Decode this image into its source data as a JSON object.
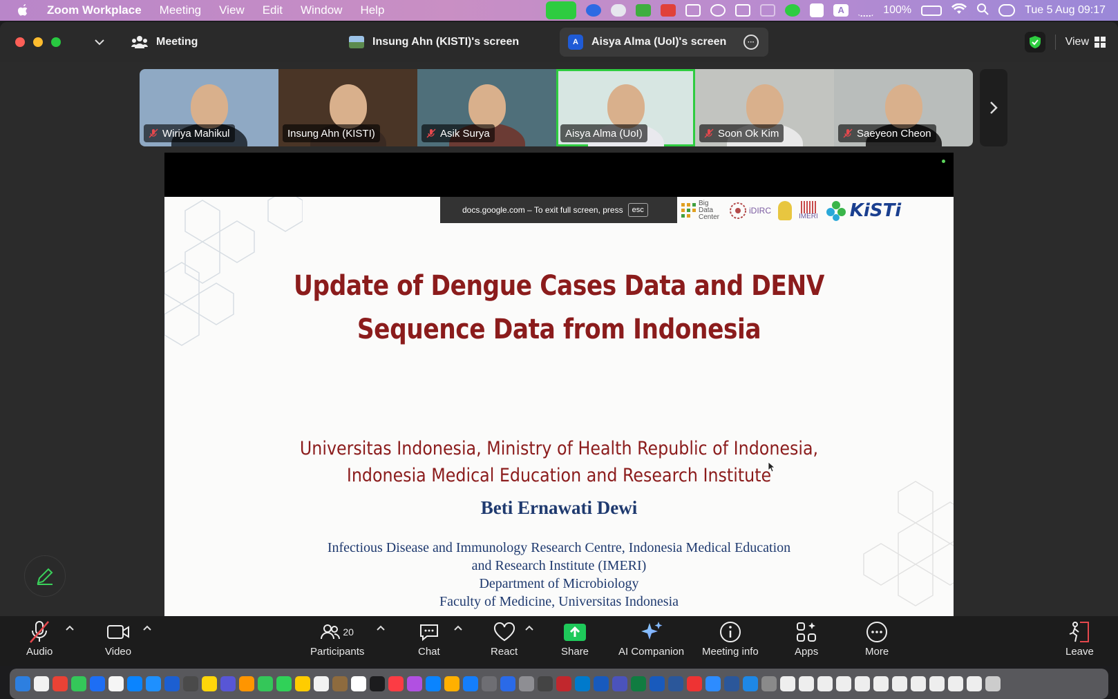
{
  "menubar": {
    "app_name": "Zoom Workplace",
    "items": [
      "Meeting",
      "View",
      "Edit",
      "Window",
      "Help"
    ],
    "battery": "100%",
    "clock": "Tue 5 Aug  09:17",
    "input_source": "A"
  },
  "titlebar": {
    "meeting_tab": "Meeting",
    "screen_tabs": [
      "Insung Ahn (KISTI)'s screen",
      "Aisya Alma (UoI)'s screen"
    ],
    "active_badge": "A",
    "view_label": "View"
  },
  "participants": [
    {
      "name": "Wiriya Mahikul",
      "muted": true,
      "bg": "#8fa9c4",
      "shirt": "#2b3540"
    },
    {
      "name": "Insung Ahn (KISTI)",
      "muted": false,
      "bg": "#4a3526",
      "shirt": "#3a2a22"
    },
    {
      "name": "Asik Surya",
      "muted": true,
      "bg": "#4f6f7a",
      "shirt": "#6b3b34"
    },
    {
      "name": "Aisya Alma (UoI)",
      "muted": false,
      "bg": "#d7e6e2",
      "shirt": "#e9e9ee",
      "active": true
    },
    {
      "name": "Soon Ok Kim",
      "muted": true,
      "bg": "#c2c4c0",
      "shirt": "#e8e8e8"
    },
    {
      "name": "Saeyeon Cheon",
      "muted": true,
      "bg": "#b9bdbb",
      "shirt": "#2a2a2a"
    }
  ],
  "shared_screen": {
    "fullscreen_notice": "docs.google.com – To exit full screen, press",
    "esc_key": "esc",
    "logos": [
      "Big Data Center",
      "iDIRC",
      "IMERI",
      "KiSTi"
    ],
    "title_lines": [
      "Update of Dengue Cases Data and DENV",
      "Sequence Data from Indonesia"
    ],
    "org_lines": [
      "Universitas Indonesia, Ministry of Health Republic of Indonesia,",
      "Indonesia Medical Education and Research Institute"
    ],
    "author": "Beti Ernawati Dewi",
    "affiliation_lines": [
      "Infectious Disease and Immunology Research Centre, Indonesia Medical Education",
      "and Research Institute (IMERI)",
      "Department of Microbiology",
      "Faculty of Medicine, Universitas Indonesia"
    ]
  },
  "toolbar": {
    "audio": "Audio",
    "video": "Video",
    "participants": "Participants",
    "participant_count": "20",
    "chat": "Chat",
    "react": "React",
    "share": "Share",
    "ai_companion": "AI Companion",
    "meeting_info": "Meeting info",
    "apps": "Apps",
    "more": "More",
    "leave": "Leave"
  },
  "colors": {
    "title_red": "#8b1c1c",
    "author_blue": "#1f3a6f",
    "active_speaker": "#2ecc40",
    "share_green": "#1ec95a",
    "leave_red": "#e5484d"
  }
}
